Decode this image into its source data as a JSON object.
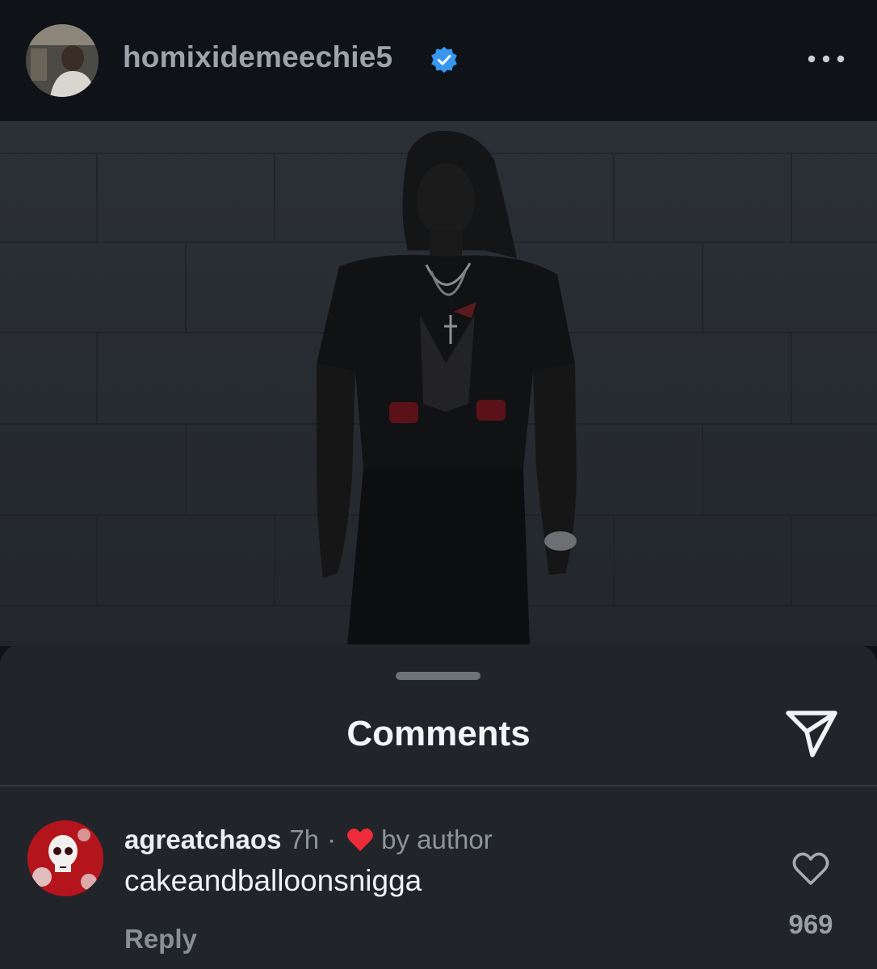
{
  "post": {
    "username": "homixidemeechie5",
    "verified_icon": "verified-badge-icon",
    "more_icon": "more-options-icon",
    "accent_color": "#3897f0"
  },
  "comments_sheet": {
    "title": "Comments",
    "share_icon": "send-icon",
    "comment": {
      "username": "agreatchaos",
      "time": "7h",
      "separator": "·",
      "liked_by_author_label": "by author",
      "text": "cakeandballoonsnigga",
      "reply_label": "Reply",
      "like_count": "969",
      "heart_color": "#ed2b3a"
    }
  }
}
